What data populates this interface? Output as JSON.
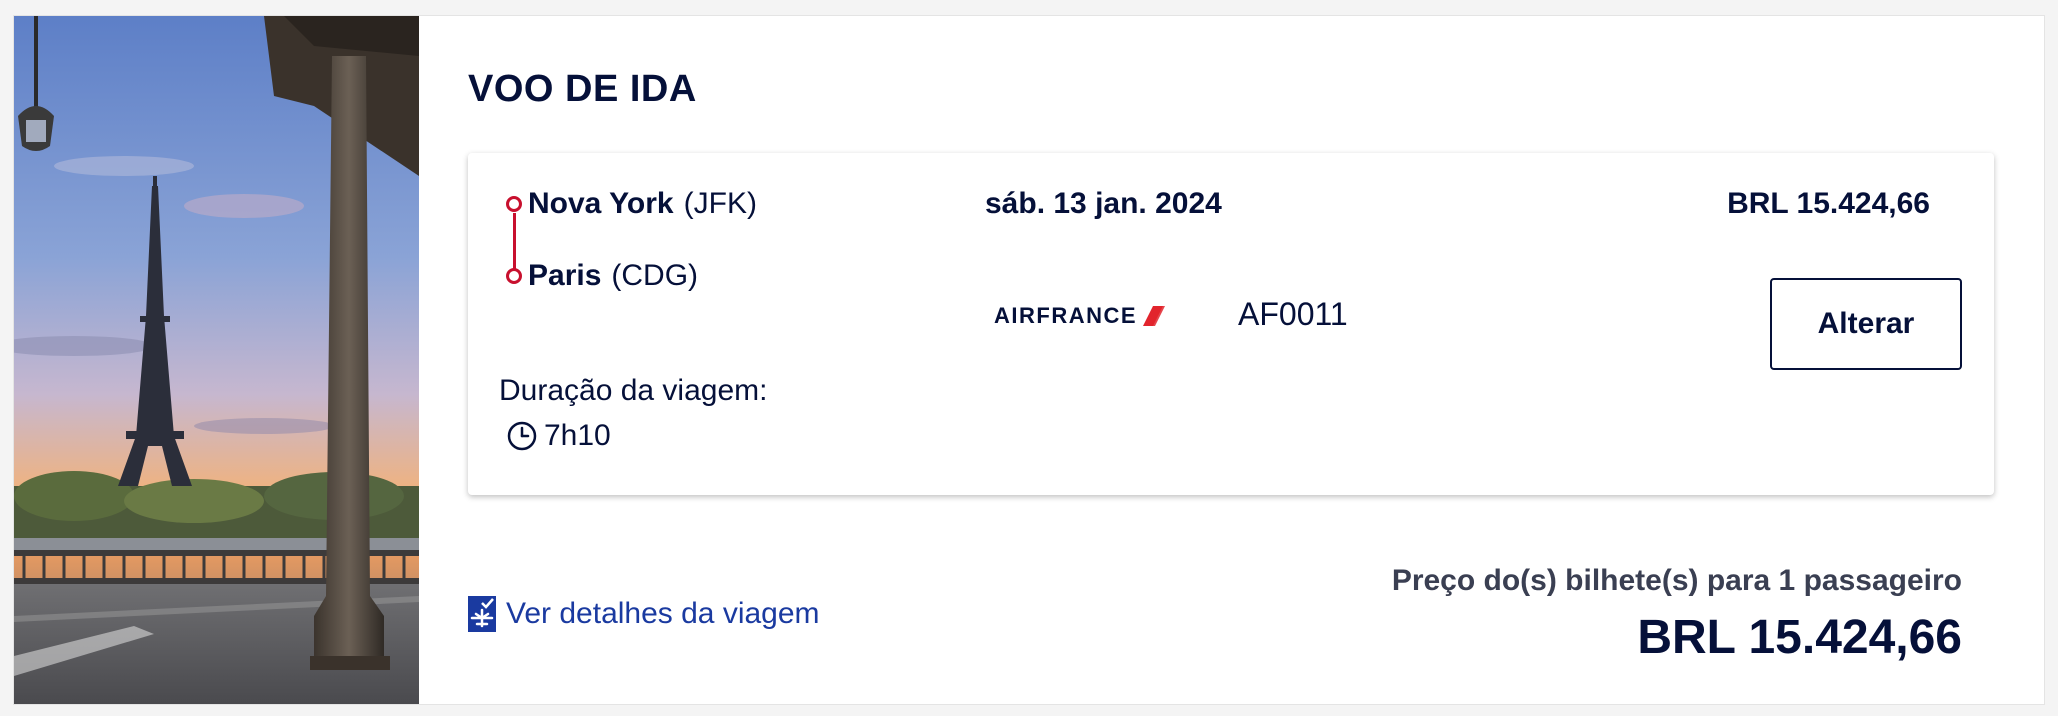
{
  "section_title": "VOO DE IDA",
  "flight": {
    "origin": {
      "city": "Nova York",
      "code": "(JFK)"
    },
    "destination": {
      "city": "Paris",
      "code": "(CDG)"
    },
    "date": "sáb. 13 jan. 2024",
    "price": "BRL 15.424,66",
    "airline": {
      "name": "AIRFRANCE",
      "logo_icon": "airfrance-logo-icon"
    },
    "flight_number": "AF0011",
    "change_label": "Alterar",
    "duration_label": "Duração da viagem:",
    "duration_value": "7h10"
  },
  "details_link": {
    "label": "Ver detalhes da viagem",
    "icon": "trip-details-icon"
  },
  "total": {
    "label": "Preço do(s) bilhete(s) para 1 passageiro",
    "price": "BRL 15.424,66"
  },
  "colors": {
    "navy": "#051039",
    "route_red": "#c8102e",
    "link_blue": "#1a3aa0"
  }
}
